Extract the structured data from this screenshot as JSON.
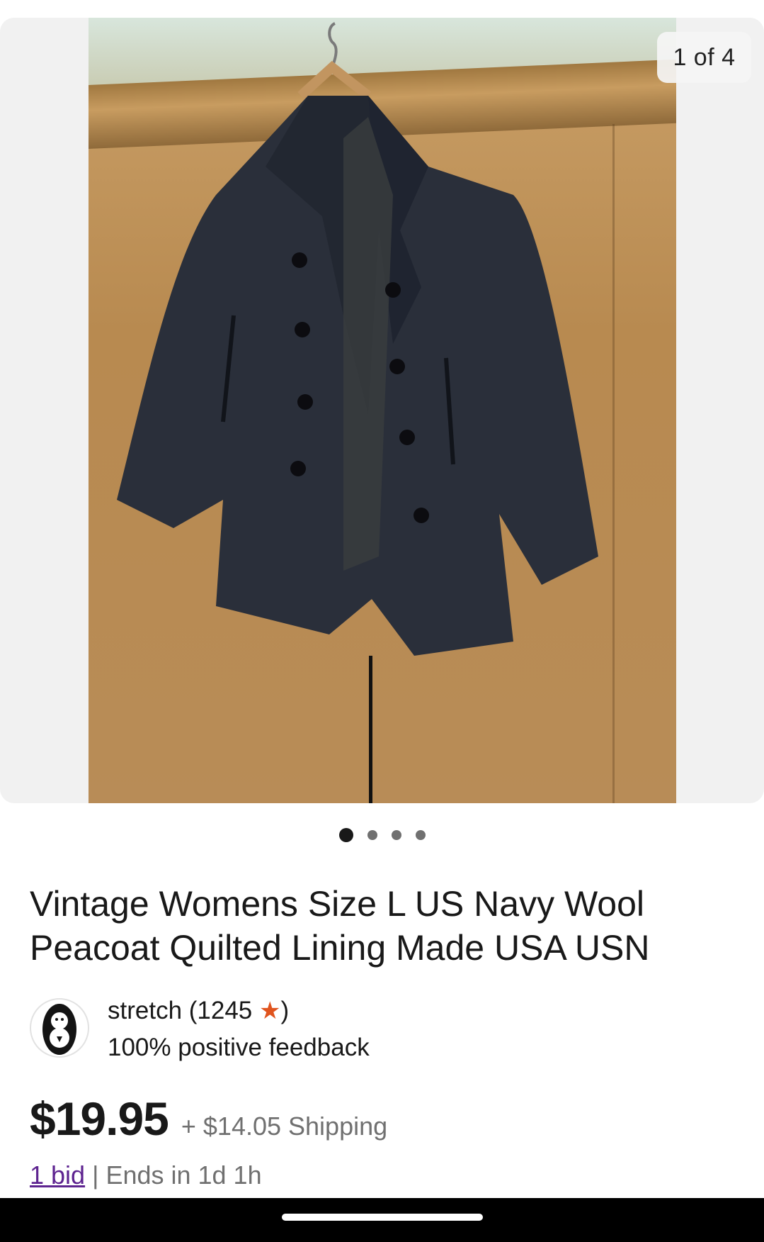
{
  "gallery": {
    "counter": "1 of 4",
    "image_alt": "Navy wool peacoat hanging on a door",
    "total_images": 4,
    "active_index": 0
  },
  "listing": {
    "title": "Vintage Womens Size L US Navy Wool Peacoat Quilted Lining Made USA USN"
  },
  "seller": {
    "name_prefix": "stretch (1245 ",
    "star": "★",
    "name_suffix": ")",
    "feedback": "100% positive feedback",
    "star_color": "#e0541e"
  },
  "price": {
    "amount": "$19.95",
    "shipping": "+ $14.05 Shipping"
  },
  "bids": {
    "bid_link": "1 bid",
    "separator": " | ",
    "ends": "Ends in 1d 1h"
  },
  "colors": {
    "accent_link": "#5e2490",
    "muted_text": "#707070",
    "text": "#191919"
  }
}
